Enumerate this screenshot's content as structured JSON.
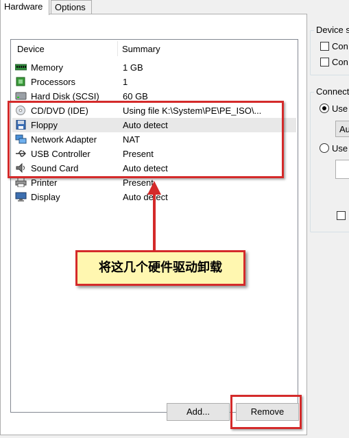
{
  "tabs": [
    {
      "label": "Hardware",
      "active": true
    },
    {
      "label": "Options",
      "active": false
    }
  ],
  "device_list": {
    "columns": [
      "Device",
      "Summary"
    ],
    "rows": [
      {
        "device": "Memory",
        "summary": "1 GB",
        "icon": "memory-icon"
      },
      {
        "device": "Processors",
        "summary": "1",
        "icon": "processor-icon"
      },
      {
        "device": "Hard Disk (SCSI)",
        "summary": "60 GB",
        "icon": "hard-disk-icon"
      },
      {
        "device": "CD/DVD (IDE)",
        "summary": "Using file K:\\System\\PE\\PE_ISO\\...",
        "icon": "cd-dvd-icon"
      },
      {
        "device": "Floppy",
        "summary": "Auto detect",
        "icon": "floppy-icon"
      },
      {
        "device": "Network Adapter",
        "summary": "NAT",
        "icon": "network-adapter-icon"
      },
      {
        "device": "USB Controller",
        "summary": "Present",
        "icon": "usb-icon"
      },
      {
        "device": "Sound Card",
        "summary": "Auto detect",
        "icon": "sound-card-icon"
      },
      {
        "device": "Printer",
        "summary": "Present",
        "icon": "printer-icon"
      },
      {
        "device": "Display",
        "summary": "Auto detect",
        "icon": "display-icon"
      }
    ]
  },
  "buttons": {
    "add": "Add...",
    "remove": "Remove"
  },
  "right_panel": {
    "device_status_label": "Device s",
    "device_status_options": [
      "Con",
      "Con"
    ],
    "connection_label": "Connect",
    "connection_options": [
      "Use",
      "Use"
    ],
    "auto_field": "Au"
  },
  "annotation": {
    "callout_text": "将这几个硬件驱动卸载",
    "color": "#d42a2a",
    "callout_bg": "#fff7b0"
  }
}
